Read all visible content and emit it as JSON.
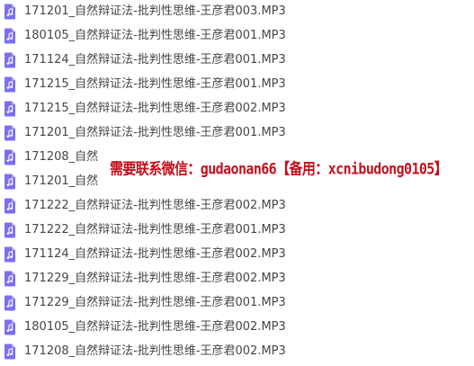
{
  "files": [
    {
      "name": "171201_自然辩证法-批判性思维-王彦君003.MP3",
      "icon": "audio-file-icon"
    },
    {
      "name": "180105_自然辩证法-批判性思维-王彦君001.MP3",
      "icon": "audio-file-icon"
    },
    {
      "name": "171124_自然辩证法-批判性思维-王彦君001.MP3",
      "icon": "audio-file-icon"
    },
    {
      "name": "171215_自然辩证法-批判性思维-王彦君001.MP3",
      "icon": "audio-file-icon"
    },
    {
      "name": "171215_自然辩证法-批判性思维-王彦君002.MP3",
      "icon": "audio-file-icon"
    },
    {
      "name": "171201_自然辩证法-批判性思维-王彦君001.MP3",
      "icon": "audio-file-icon"
    },
    {
      "name": "171208_自然",
      "icon": "audio-file-icon"
    },
    {
      "name": "171201_自然",
      "icon": "audio-file-icon"
    },
    {
      "name": "171222_自然辩证法-批判性思维-王彦君002.MP3",
      "icon": "audio-file-icon"
    },
    {
      "name": "171222_自然辩证法-批判性思维-王彦君001.MP3",
      "icon": "audio-file-icon"
    },
    {
      "name": "171124_自然辩证法-批判性思维-王彦君002.MP3",
      "icon": "audio-file-icon"
    },
    {
      "name": "171229_自然辩证法-批判性思维-王彦君002.MP3",
      "icon": "audio-file-icon"
    },
    {
      "name": "171229_自然辩证法-批判性思维-王彦君001.MP3",
      "icon": "audio-file-icon"
    },
    {
      "name": "180105_自然辩证法-批判性思维-王彦君002.MP3",
      "icon": "audio-file-icon"
    },
    {
      "name": "171208_自然辩证法-批判性思维-王彦君002.MP3",
      "icon": "audio-file-icon"
    }
  ],
  "watermark": {
    "text": "需要联系微信：gudaonan66【备用：xcnibudong0105】"
  },
  "colors": {
    "icon_purple": "#7b6ff0",
    "file_text": "#454545",
    "watermark_red": "#c4101d"
  }
}
